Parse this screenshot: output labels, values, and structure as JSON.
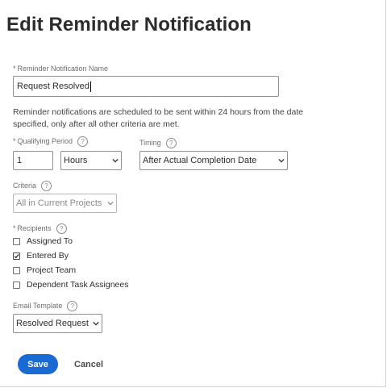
{
  "dialog": {
    "title": "Edit Reminder Notification"
  },
  "name_field": {
    "label": "Reminder Notification Name",
    "value": "Request Resolved"
  },
  "note": "Reminder notifications are scheduled to be sent within 24 hours from the date specified, only after all other criteria are met.",
  "qualifying_period": {
    "label": "Qualifying Period",
    "value": "1",
    "unit": "Hours"
  },
  "timing": {
    "label": "Timing",
    "value": "After Actual Completion Date"
  },
  "criteria": {
    "label": "Criteria",
    "value": "All in Current Projects"
  },
  "recipients": {
    "label": "Recipients",
    "items": [
      {
        "label": "Assigned To",
        "checked": false
      },
      {
        "label": "Entered By",
        "checked": true
      },
      {
        "label": "Project Team",
        "checked": false
      },
      {
        "label": "Dependent Task Assignees",
        "checked": false
      }
    ]
  },
  "email_template": {
    "label": "Email Template",
    "value": "Resolved Request"
  },
  "actions": {
    "save_label": "Save",
    "cancel_label": "Cancel"
  },
  "required_marker": "*",
  "help_glyph": "?",
  "colors": {
    "primary": "#1a6ad4",
    "text": "#2c2c2c",
    "muted": "#6e6e6e"
  }
}
